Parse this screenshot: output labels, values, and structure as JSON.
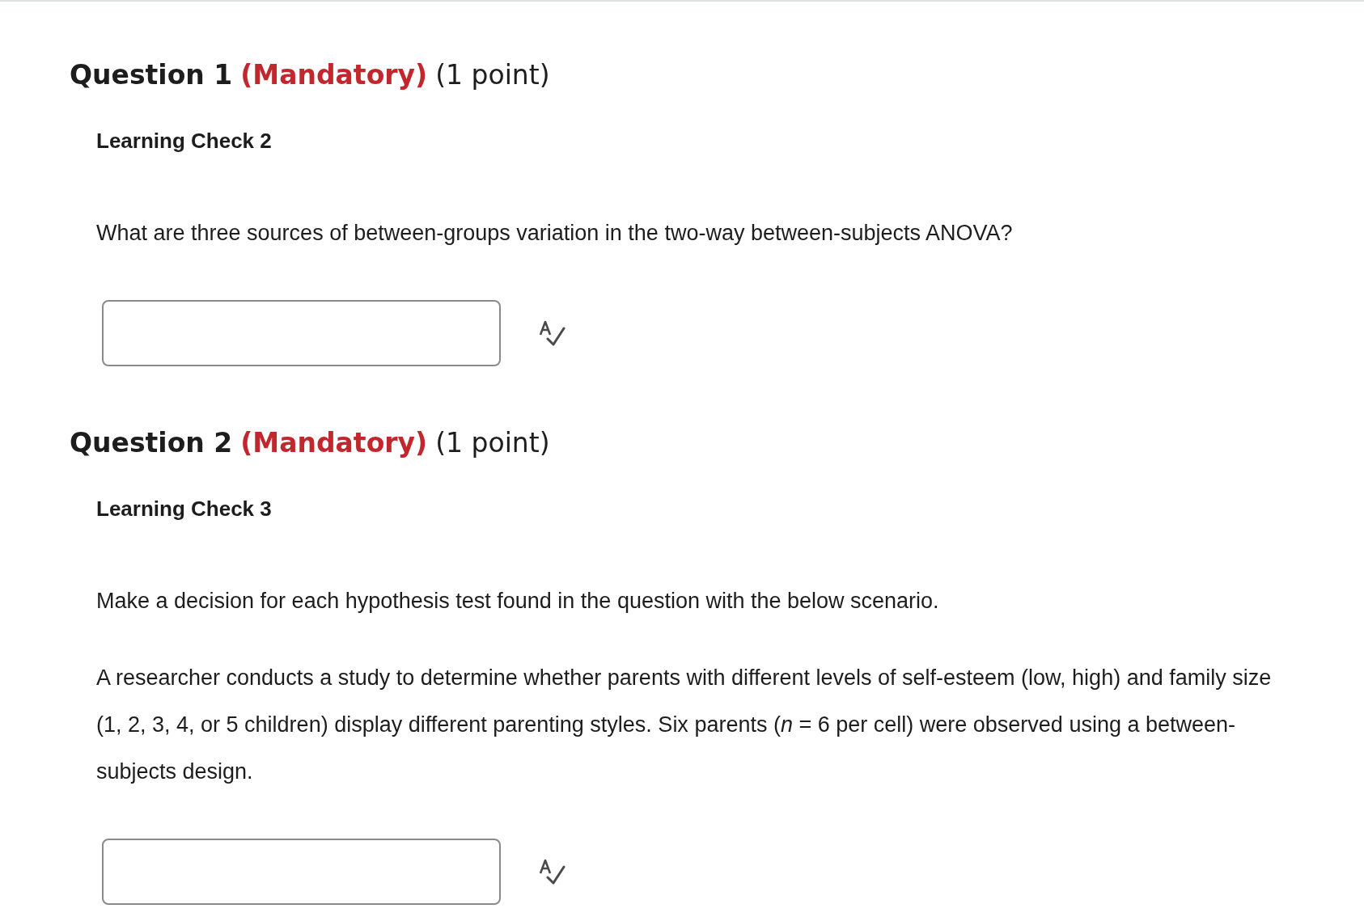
{
  "questions": [
    {
      "heading": "Question 1",
      "mandatory": "(Mandatory)",
      "points": "(1 point)",
      "title": "Learning Check 2",
      "paragraphs": [
        "What are three sources of between-groups variation in the two-way between-subjects ANOVA?"
      ]
    },
    {
      "heading": "Question 2",
      "mandatory": "(Mandatory)",
      "points": "(1 point)",
      "title": "Learning Check 3",
      "paragraphs": [
        "Make a decision for each hypothesis test found in the question with the below scenario.",
        "A researcher conducts a study to determine whether parents with different levels of self-esteem (low, high) and family size (1, 2, 3, 4, or 5 children) display different parenting styles. Six parents (*n* = 6 per cell) were observed using a between-subjects design."
      ]
    }
  ]
}
